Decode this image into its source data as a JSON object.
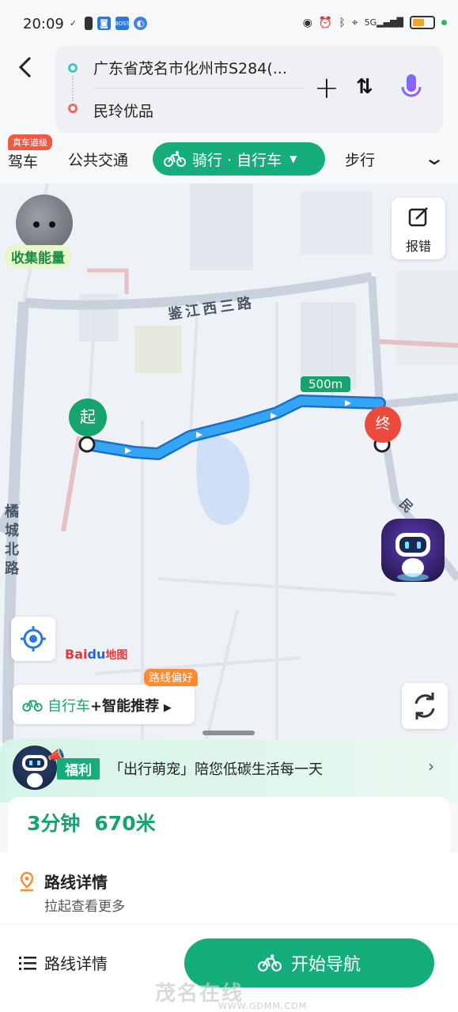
{
  "status_bar": {
    "time": "20:09",
    "network": "5G"
  },
  "header": {
    "start_location": "广东省茂名市化州市S284(...",
    "end_location": "民玲优品",
    "add_label": "+",
    "swap_label": "⇅"
  },
  "tabs": {
    "items": [
      {
        "label": "驾车",
        "badge": "真车道级"
      },
      {
        "label": "公共交通"
      },
      {
        "label": "骑行 · 自行车",
        "active": true
      },
      {
        "label": "步行"
      }
    ]
  },
  "map": {
    "energy_label": "收集能量",
    "report_label": "报错",
    "street_east_west": "鉴江西三路",
    "street_vertical": "橘城北路",
    "street_right": "民",
    "distance_badge": "500m",
    "start_pin": "起",
    "end_pin": "终",
    "baidu_logo": "Bai",
    "baidu_logo_blue": "du",
    "baidu_logo_map": "地图",
    "preference_mode": "自行车",
    "preference_text": "+智能推荐",
    "preference_badge": "路线偏好"
  },
  "promo": {
    "tag": "福利",
    "text": "「出行萌宠」陪您低碳生活每一天"
  },
  "summary": {
    "duration": "3分钟",
    "distance": "670米"
  },
  "route_detail": {
    "title": "路线详情",
    "subtitle": "拉起查看更多"
  },
  "bottom_bar": {
    "list_label": "路线详情",
    "nav_label": "开始导航"
  },
  "watermark": {
    "text": "茂名在线",
    "url": "WWW.GDMM.COM"
  },
  "colors": {
    "accent": "#16ad7c",
    "route": "#2d8ff0",
    "end": "#ec4a3c"
  }
}
